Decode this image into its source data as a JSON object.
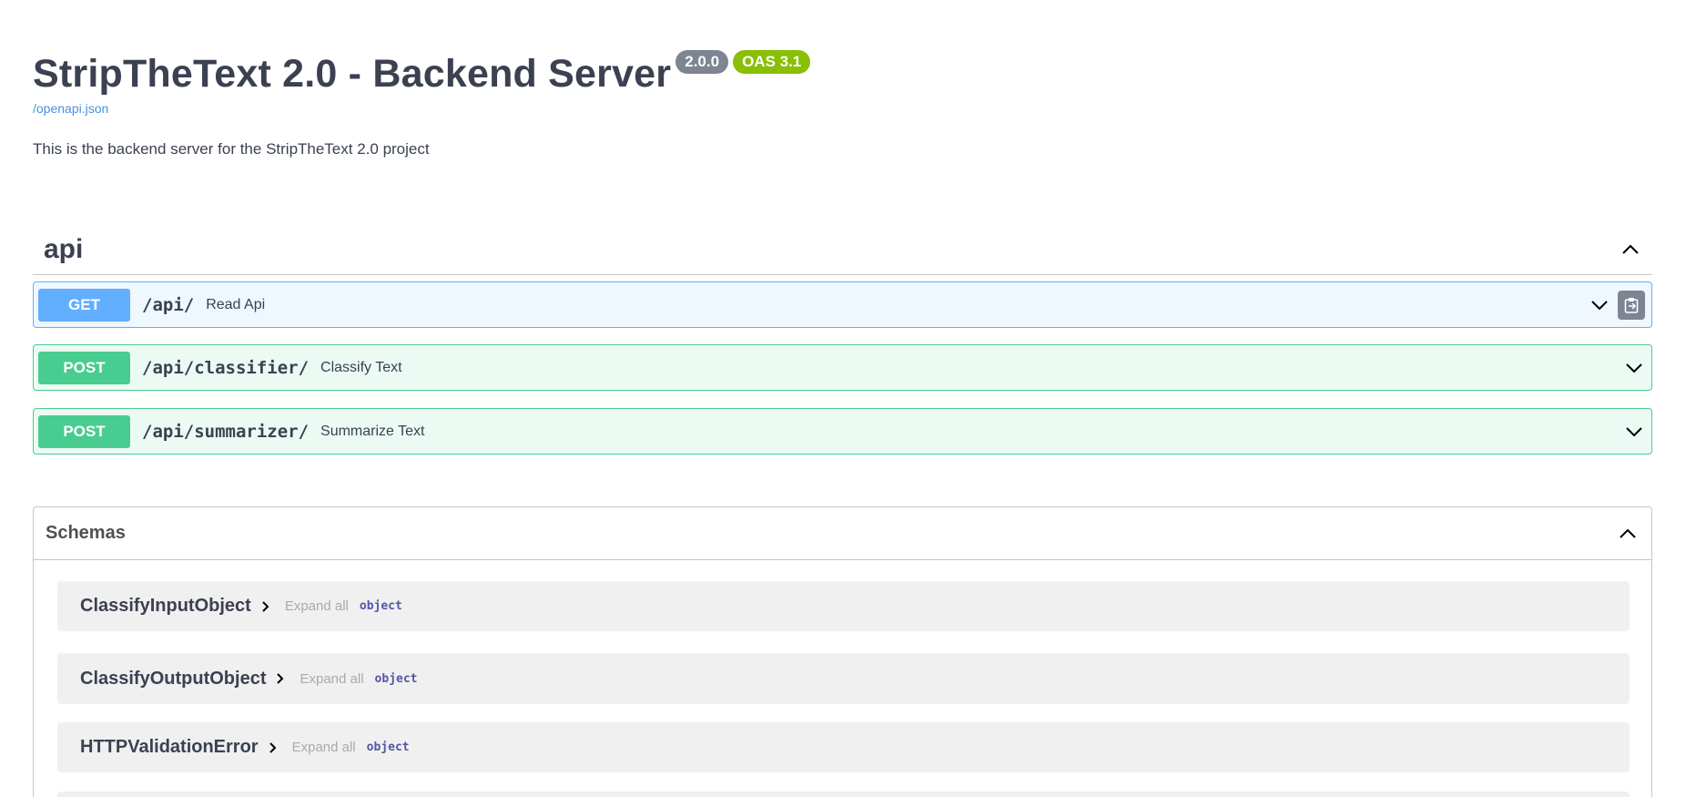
{
  "info": {
    "title": "StripTheText 2.0 - Backend Server",
    "version_badge": "2.0.0",
    "oas_badge": "OAS 3.1",
    "spec_link": "/openapi.json",
    "description": "This is the backend server for the StripTheText 2.0 project"
  },
  "tag": {
    "name": "api"
  },
  "operations": [
    {
      "method": "GET",
      "path": "/api/",
      "summary": "Read Api"
    },
    {
      "method": "POST",
      "path": "/api/classifier/",
      "summary": "Classify Text"
    },
    {
      "method": "POST",
      "path": "/api/summarizer/",
      "summary": "Summarize Text"
    }
  ],
  "schemas": {
    "title": "Schemas",
    "items": [
      {
        "name": "ClassifyInputObject",
        "expand_label": "Expand all",
        "type": "object"
      },
      {
        "name": "ClassifyOutputObject",
        "expand_label": "Expand all",
        "type": "object"
      },
      {
        "name": "HTTPValidationError",
        "expand_label": "Expand all",
        "type": "object"
      }
    ]
  },
  "colors": {
    "get": "#61affe",
    "post": "#49cc90",
    "version_badge": "#7d8492",
    "oas_badge": "#89bf04",
    "link": "#4990e2"
  },
  "icons": {
    "collapse": "chevron-up-icon",
    "expand": "chevron-down-icon",
    "copy": "clipboard-icon",
    "model_expand": "chevron-right-icon"
  }
}
